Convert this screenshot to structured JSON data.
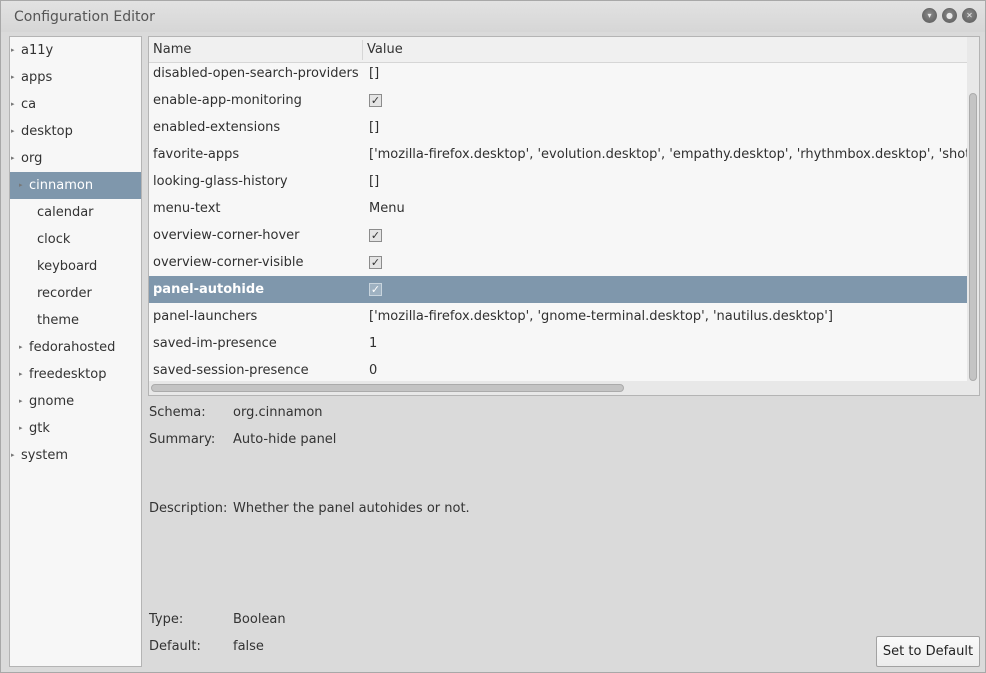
{
  "window": {
    "title": "Configuration Editor"
  },
  "sidebar": {
    "items": [
      {
        "label": "a11y",
        "expandable": true
      },
      {
        "label": "apps",
        "expandable": true
      },
      {
        "label": "ca",
        "expandable": true
      },
      {
        "label": "desktop",
        "expandable": true
      },
      {
        "label": "org",
        "expandable": true
      },
      {
        "label": "cinnamon",
        "expandable": true,
        "selected": true
      },
      {
        "label": "calendar",
        "expandable": false
      },
      {
        "label": "clock",
        "expandable": false
      },
      {
        "label": "keyboard",
        "expandable": false
      },
      {
        "label": "recorder",
        "expandable": false
      },
      {
        "label": "theme",
        "expandable": false
      },
      {
        "label": "fedorahosted",
        "expandable": true
      },
      {
        "label": "freedesktop",
        "expandable": true
      },
      {
        "label": "gnome",
        "expandable": true
      },
      {
        "label": "gtk",
        "expandable": true
      },
      {
        "label": "system",
        "expandable": true
      }
    ]
  },
  "table": {
    "columns": {
      "name": "Name",
      "value": "Value"
    },
    "rows": [
      {
        "name": "disabled-open-search-providers",
        "value": "[]"
      },
      {
        "name": "enable-app-monitoring",
        "value": "",
        "checked": true
      },
      {
        "name": "enabled-extensions",
        "value": "[]"
      },
      {
        "name": "favorite-apps",
        "value": "['mozilla-firefox.desktop', 'evolution.desktop', 'empathy.desktop', 'rhythmbox.desktop', 'shotw"
      },
      {
        "name": "looking-glass-history",
        "value": "[]"
      },
      {
        "name": "menu-text",
        "value": "Menu"
      },
      {
        "name": "overview-corner-hover",
        "value": "",
        "checked": true
      },
      {
        "name": "overview-corner-visible",
        "value": "",
        "checked": true
      },
      {
        "name": "panel-autohide",
        "value": "",
        "checked": true,
        "selected": true
      },
      {
        "name": "panel-launchers",
        "value": "['mozilla-firefox.desktop', 'gnome-terminal.desktop', 'nautilus.desktop']"
      },
      {
        "name": "saved-im-presence",
        "value": "1"
      },
      {
        "name": "saved-session-presence",
        "value": "0"
      }
    ]
  },
  "details": {
    "schema_label": "Schema:",
    "schema_value": "org.cinnamon",
    "summary_label": "Summary:",
    "summary_value": "Auto-hide panel",
    "description_label": "Description:",
    "description_value": "Whether the panel autohides or not.",
    "type_label": "Type:",
    "type_value": "Boolean",
    "default_label": "Default:",
    "default_value": "false"
  },
  "actions": {
    "set_default_label": "Set to Default"
  },
  "colors": {
    "selection": "#7f97ac"
  },
  "icons": {
    "minimize": "chevron-down-icon",
    "maximize": "circle-icon",
    "close": "x-icon",
    "expander": "triangle-right-icon",
    "check": "checkmark-icon"
  }
}
